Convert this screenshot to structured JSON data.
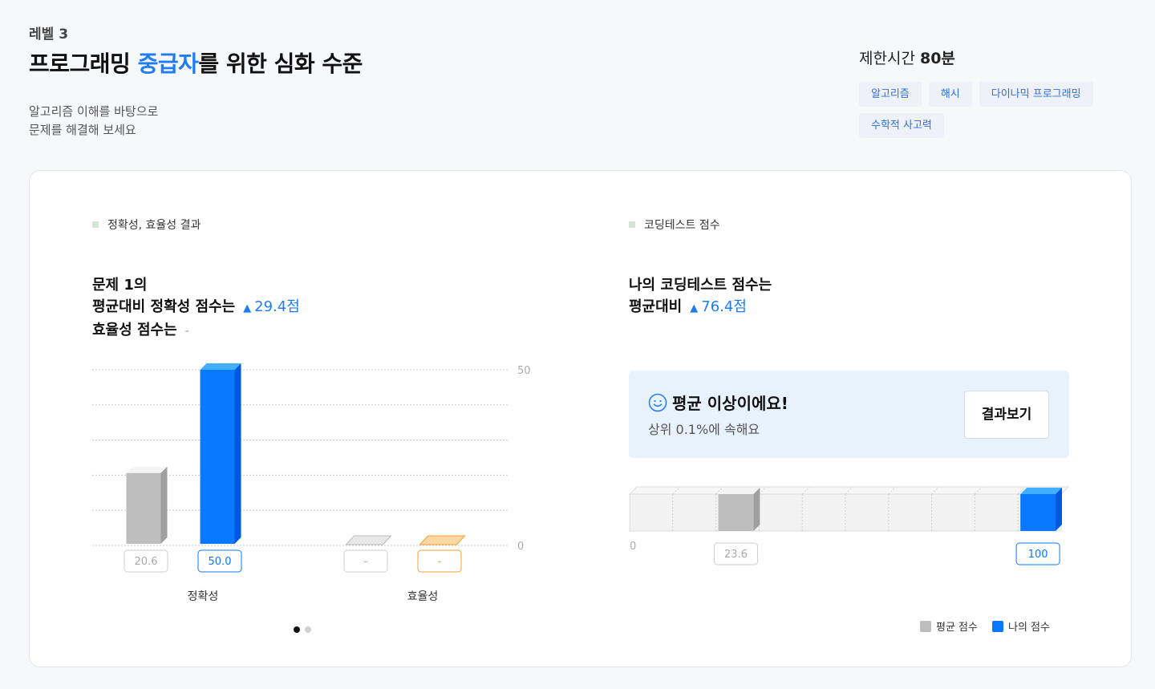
{
  "header": {
    "level": "레벨 3",
    "title_prefix": "프로그래밍 ",
    "title_highlight": "중급자",
    "title_suffix": "를 위한 심화 수준",
    "desc_line1": "알고리즘 이해를 바탕으로",
    "desc_line2": "문제를 해결해 보세요",
    "time_label": "제한시간",
    "time_value": "80분",
    "tags": [
      "알고리즘",
      "해시",
      "다이나믹 프로그래밍",
      "수학적 사고력"
    ]
  },
  "left_panel": {
    "section_label": "정확성, 효율성 결과",
    "line1": "문제 1의",
    "line2_prefix": "평균대비 정확성 점수는",
    "line2_value": "29.4점",
    "line3_prefix": "효율성 점수는",
    "line3_value": "-",
    "up_icon": "triangle-up-icon"
  },
  "right_panel": {
    "section_label": "코딩테스트 점수",
    "line1": "나의 코딩테스트 점수는",
    "line2_prefix": "평균대비",
    "line2_value": "76.4점",
    "up_icon": "triangle-up-icon",
    "status_icon": "smile-icon",
    "status_title": "평균 이상이에요!",
    "status_sub": "상위 0.1%에 속해요",
    "result_button": "결과보기",
    "legend": [
      {
        "label": "평균 점수",
        "color": "#bdbdbd"
      },
      {
        "label": "나의 점수",
        "color": "#0a78ff"
      }
    ]
  },
  "chart_data": [
    {
      "type": "bar",
      "categories": [
        "정확성",
        "효율성"
      ],
      "series": [
        {
          "name": "평균 점수",
          "values": [
            20.6,
            null
          ],
          "labels": [
            "20.6",
            "-"
          ]
        },
        {
          "name": "나의 점수",
          "values": [
            50.0,
            null
          ],
          "labels": [
            "50.0",
            "-"
          ]
        }
      ],
      "yticks": [
        "0",
        "50"
      ],
      "ylim": [
        0,
        50
      ],
      "colors": {
        "avg": "#bdbdbd",
        "mine": "#0a78ff",
        "mine_efficiency": "#f6a020"
      }
    },
    {
      "type": "bar",
      "orientation": "horizontal",
      "series": [
        {
          "name": "평균 점수",
          "value": 23.6,
          "label": "23.6"
        },
        {
          "name": "나의 점수",
          "value": 100,
          "label": "100"
        }
      ],
      "min_label": "0",
      "xlim": [
        0,
        100
      ]
    }
  ],
  "pagination": {
    "count": 2,
    "active": 0
  }
}
